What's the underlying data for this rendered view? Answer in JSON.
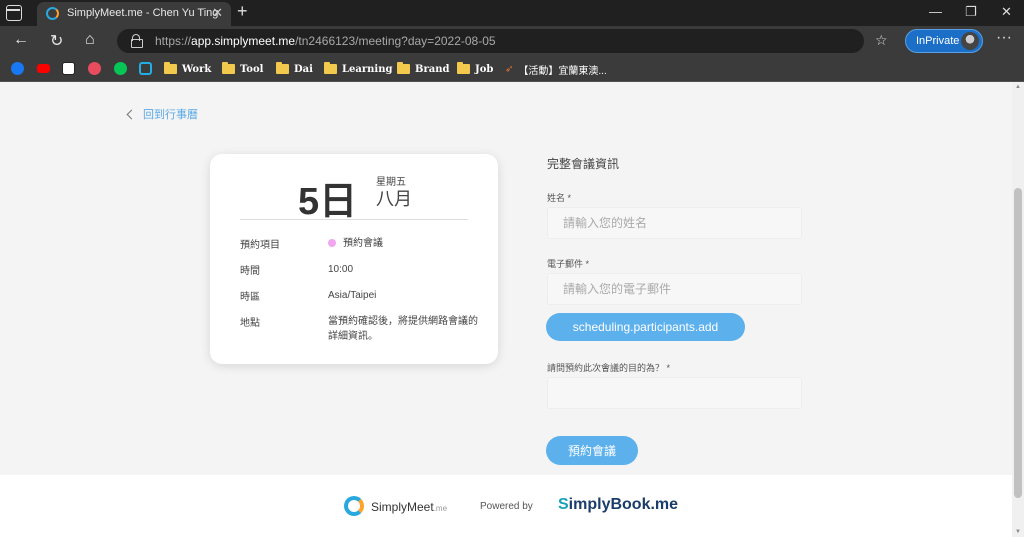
{
  "browser": {
    "tab_title": "SimplyMeet.me - Chen Yu Ting",
    "url_scheme": "https://",
    "url_host": "app.simplymeet.me",
    "url_path": "/tn2466123/meeting?day=2022-08-05",
    "inprivate_label": "InPrivate",
    "bookmarks": [
      {
        "icon": "facebook-icon",
        "color": "#1877f2"
      },
      {
        "icon": "youtube-icon",
        "color": "#ff0000"
      },
      {
        "icon": "notion-icon",
        "color": "#ffffff"
      },
      {
        "icon": "app-icon",
        "color": "#e94c5f"
      },
      {
        "icon": "line-icon",
        "color": "#06c755"
      },
      {
        "icon": "bilibili-icon",
        "color": "#23ade5"
      }
    ],
    "folders": [
      "Work",
      "Tool",
      "Dai",
      "Learning",
      "Brand",
      "Job"
    ],
    "extra_bookmark": "【活動】宜蘭東澳..."
  },
  "page": {
    "back_label": "回到行事曆",
    "card": {
      "day": "5日",
      "weekday": "星期五",
      "month": "八月",
      "rows": [
        {
          "label": "預約項目",
          "value": "預約會議"
        },
        {
          "label": "時間",
          "value": "10:00"
        },
        {
          "label": "時區",
          "value": "Asia/Taipei"
        },
        {
          "label": "地點",
          "value": "當預約確認後，將提供網路會議的詳細資訊。"
        }
      ],
      "dot_color": "#f0a7f0"
    },
    "form": {
      "title": "完整會議資訊",
      "name_label": "姓名 *",
      "name_placeholder": "請輸入您的姓名",
      "email_label": "電子郵件 *",
      "email_placeholder": "請輸入您的電子郵件",
      "add_participants": "scheduling.participants.add",
      "purpose_label": "請問預約此次會議的目的為？ *",
      "purpose_value": "",
      "submit_label": "預約會議"
    },
    "footer": {
      "simplymeet_name": "SimplyMeet",
      "simplymeet_suffix": ".me",
      "powered_by": "Powered by",
      "simplybook_s": "S",
      "simplybook_rest": "implyBook.me"
    },
    "accent_color": "#5cb0ec"
  }
}
